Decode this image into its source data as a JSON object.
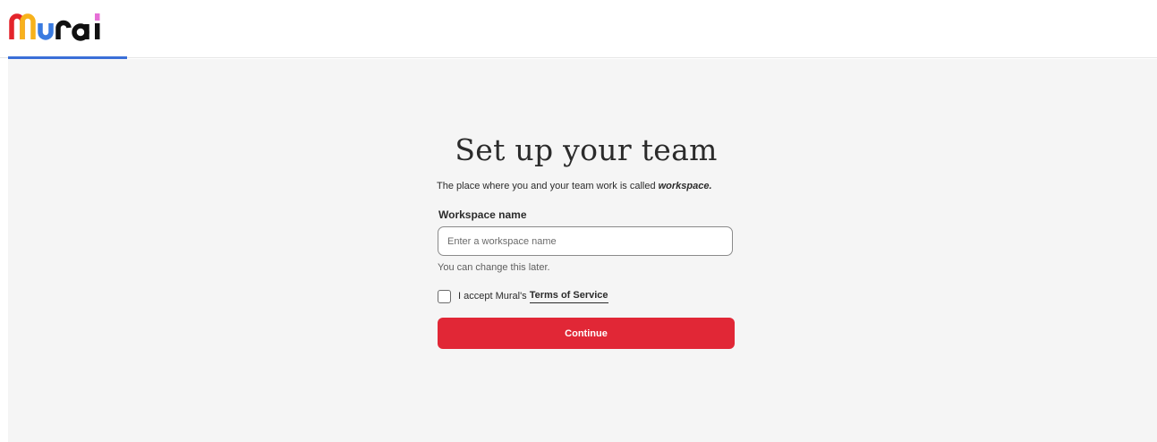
{
  "header": {
    "logo_icon": "mural-logo",
    "logo_text": "Mural",
    "accent_color": "#3a6fd8"
  },
  "form": {
    "title": "Set up your team",
    "subtitle_prefix": "The place where you and your team work is called ",
    "subtitle_emphasis": "workspace.",
    "workspace_label": "Workspace name",
    "workspace_value": "",
    "workspace_placeholder": "Enter a workspace name",
    "helper_text": "You can change this later.",
    "terms_prefix": "I accept Mural's",
    "terms_link": "Terms of Service",
    "terms_checked": false,
    "continue_label": "Continue",
    "button_color": "#e12736"
  }
}
